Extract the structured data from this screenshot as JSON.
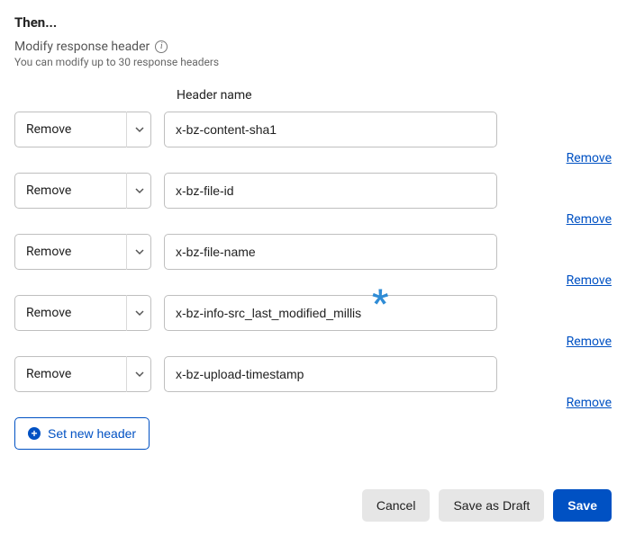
{
  "section": {
    "title": "Then...",
    "subtitle": "Modify response header",
    "hint": "You can modify up to 30 response headers",
    "columnLabel": "Header name"
  },
  "actionOption": "Remove",
  "removeLink": "Remove",
  "rows": [
    {
      "action": "Remove",
      "headerName": "x-bz-content-sha1"
    },
    {
      "action": "Remove",
      "headerName": "x-bz-file-id"
    },
    {
      "action": "Remove",
      "headerName": "x-bz-file-name"
    },
    {
      "action": "Remove",
      "headerName": "x-bz-info-src_last_modified_millis"
    },
    {
      "action": "Remove",
      "headerName": "x-bz-upload-timestamp"
    }
  ],
  "addButton": "Set new header",
  "footer": {
    "cancel": "Cancel",
    "draft": "Save as Draft",
    "save": "Save"
  }
}
